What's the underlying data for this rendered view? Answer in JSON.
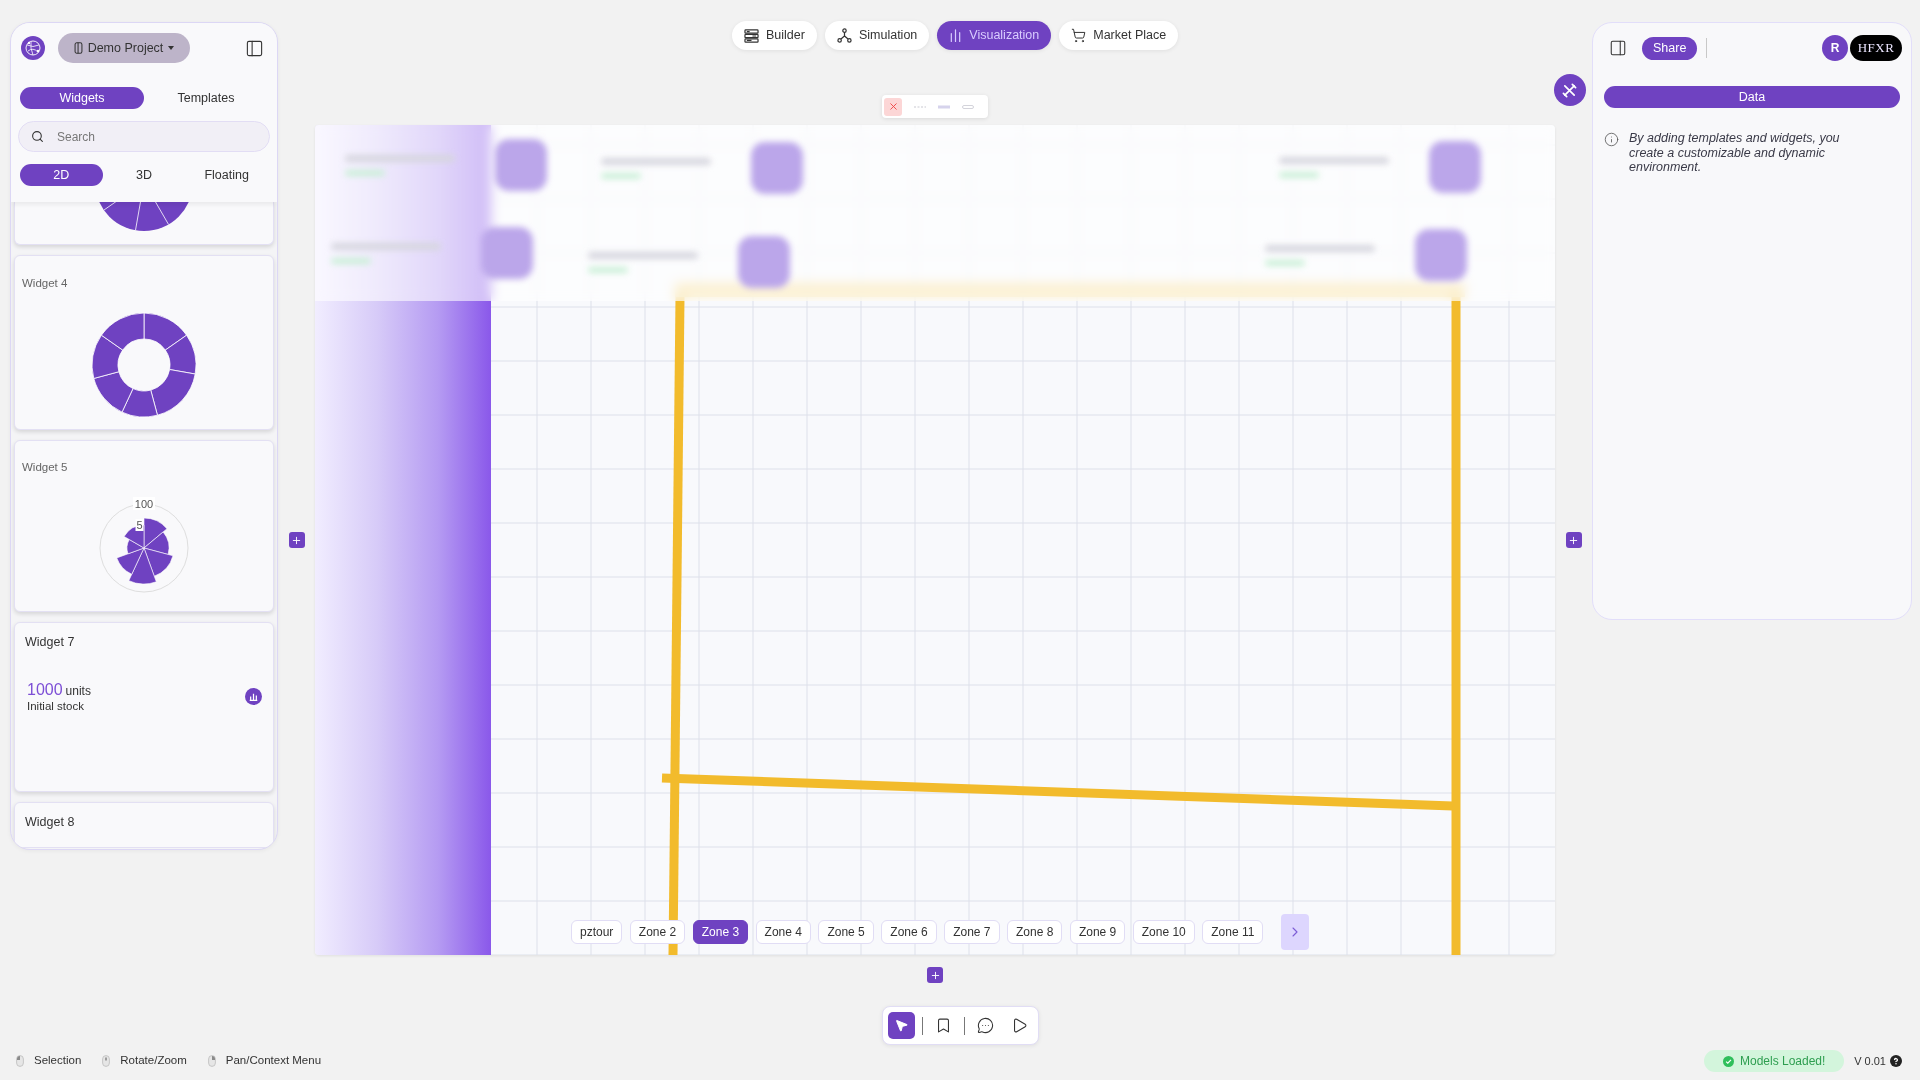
{
  "sidebar": {
    "project": {
      "name": "Demo Project"
    },
    "tabs": [
      {
        "label": "Widgets",
        "selected": true
      },
      {
        "label": "Templates",
        "selected": false
      }
    ],
    "search": {
      "placeholder": "Search"
    },
    "view_tabs": [
      {
        "label": "2D",
        "selected": true
      },
      {
        "label": "3D",
        "selected": false
      },
      {
        "label": "Floating",
        "selected": false
      }
    ],
    "widgets": [
      {
        "kind": "pie"
      },
      {
        "kind": "donut",
        "title": "Widget 4"
      },
      {
        "kind": "polar",
        "title": "Widget 5",
        "tick_labels": [
          "100",
          "5"
        ]
      },
      {
        "kind": "stat",
        "title": "Widget 7",
        "value": "1000",
        "unit": "units",
        "caption": "Initial stock"
      },
      {
        "kind": "stat",
        "title": "Widget 8"
      }
    ]
  },
  "top_nav": [
    {
      "kind": "builder",
      "label": "Builder",
      "selected": false
    },
    {
      "kind": "simulation",
      "label": "Simulation",
      "selected": false
    },
    {
      "kind": "visualization",
      "label": "Visualization",
      "selected": true
    },
    {
      "kind": "marketplace",
      "label": "Market Place",
      "selected": false
    }
  ],
  "canvas": {
    "zones": [
      {
        "label": "pztour",
        "selected": false
      },
      {
        "label": "Zone 2",
        "selected": false
      },
      {
        "label": "Zone 3",
        "selected": true
      },
      {
        "label": "Zone 4",
        "selected": false
      },
      {
        "label": "Zone 5",
        "selected": false
      },
      {
        "label": "Zone 6",
        "selected": false
      },
      {
        "label": "Zone 7",
        "selected": false
      },
      {
        "label": "Zone 8",
        "selected": false
      },
      {
        "label": "Zone 9",
        "selected": false
      },
      {
        "label": "Zone 10",
        "selected": false
      },
      {
        "label": "Zone 11",
        "selected": false
      }
    ]
  },
  "right_panel": {
    "share_label": "Share",
    "avatar": "R",
    "brand": "HFXR",
    "data_label": "Data",
    "info": "By adding templates and widgets, you create a customizable and dynamic environment."
  },
  "bottom_toolbar": [
    {
      "kind": "select",
      "selected": true
    },
    {
      "kind": "bookmark",
      "selected": false
    },
    {
      "kind": "comment",
      "selected": false
    },
    {
      "kind": "play",
      "selected": false
    }
  ],
  "status_bar": {
    "hints": [
      {
        "kind": "left",
        "label": "Selection"
      },
      {
        "kind": "middle",
        "label": "Rotate/Zoom"
      },
      {
        "kind": "right",
        "label": "Pan/Context Menu"
      }
    ],
    "status": "Models Loaded!",
    "version": "V 0.01"
  }
}
